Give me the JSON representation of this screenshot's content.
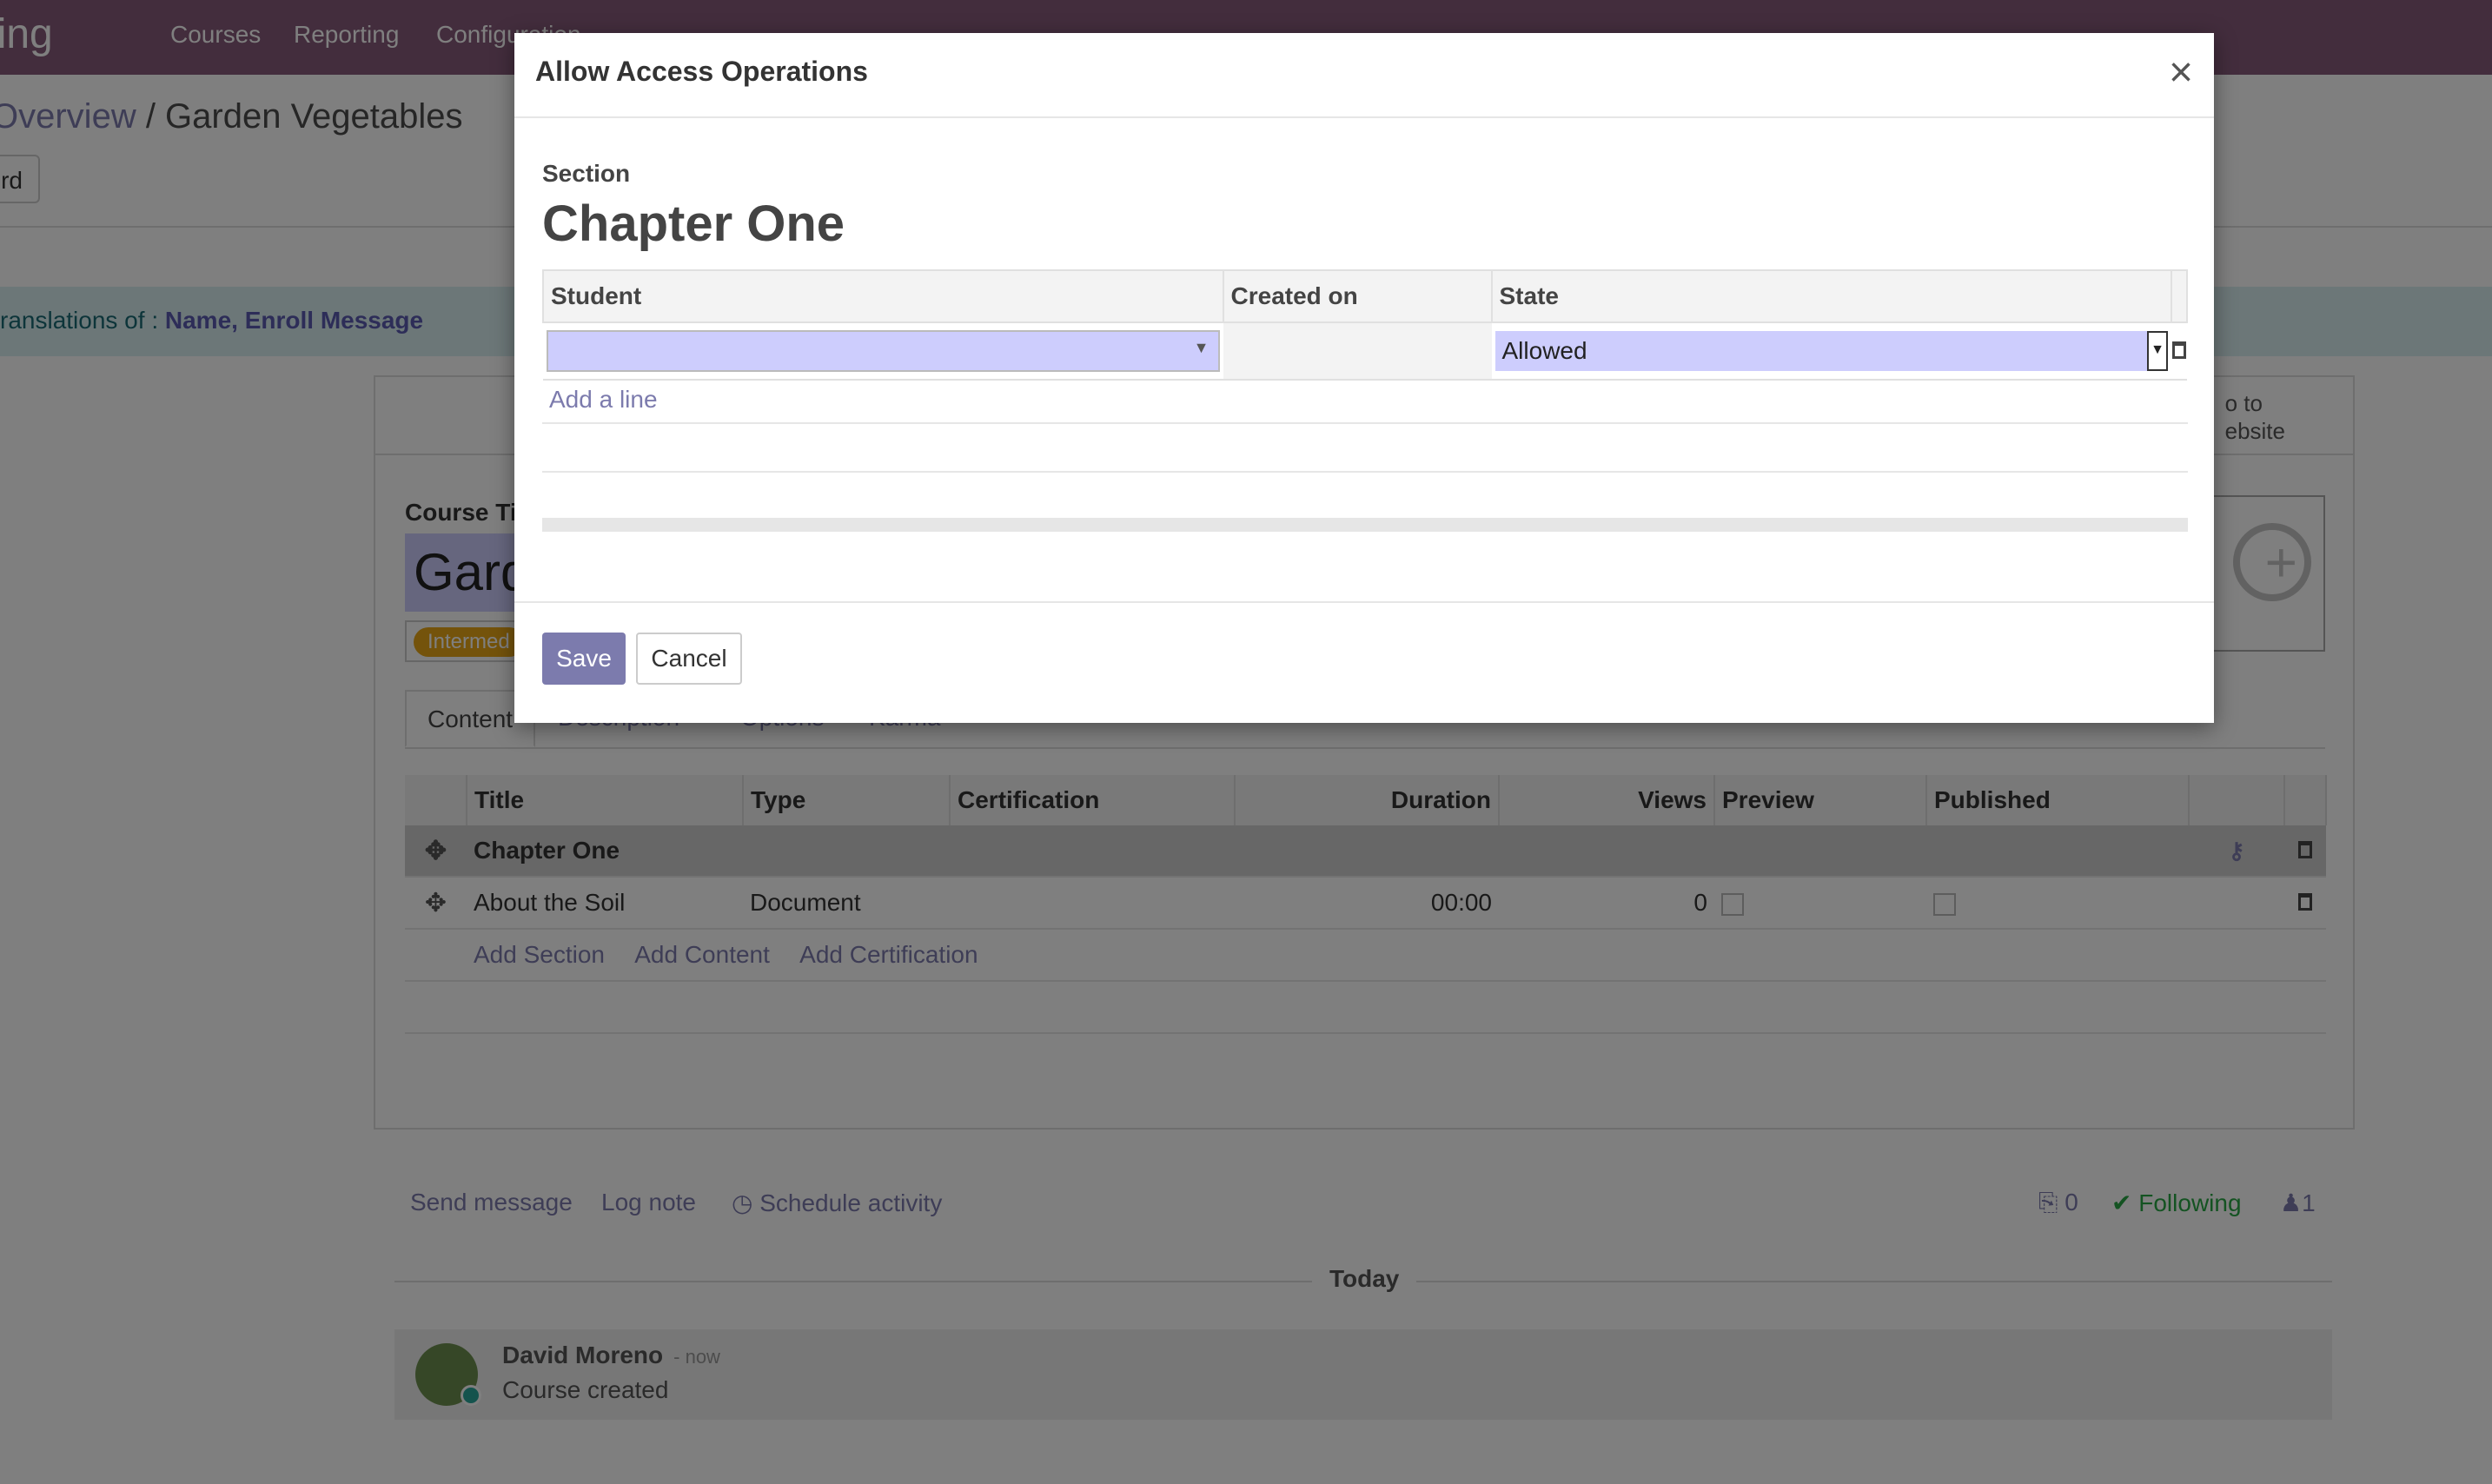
{
  "app": {
    "brand": "ning",
    "menu": [
      "Courses",
      "Reporting",
      "Configuration"
    ]
  },
  "breadcrumb": {
    "parent": "Overview",
    "separator": " / ",
    "current": "Garden Vegetables"
  },
  "control_panel": {
    "board_button": "rd"
  },
  "translation_alert": {
    "text": "ranslations of : ",
    "fields": "Name, Enroll Message"
  },
  "form": {
    "goto_website": "o to\nebsite",
    "course_title_label": "Course Ti",
    "course_title_value": "Gard",
    "tag": "Intermed",
    "tabs": [
      "Content",
      "Description",
      "Options",
      "Karma"
    ],
    "content_table": {
      "headers": [
        "",
        "Title",
        "Type",
        "Certification",
        "Duration",
        "Views",
        "Preview",
        "Published",
        "",
        ""
      ],
      "rows": [
        {
          "kind": "section",
          "title": "Chapter One"
        },
        {
          "kind": "line",
          "title": "About the Soil",
          "type": "Document",
          "certification": "",
          "duration": "00:00",
          "views": "0"
        }
      ],
      "add_links": [
        "Add Section",
        "Add Content",
        "Add Certification"
      ]
    }
  },
  "chatter": {
    "send_message": "Send message",
    "log_note": "Log note",
    "schedule_activity": "Schedule activity",
    "attachments_count": "0",
    "following": "Following",
    "followers_count": "1",
    "separator_label": "Today",
    "messages": [
      {
        "author": "David Moreno",
        "when": "- now",
        "body": "Course created"
      }
    ]
  },
  "dialog": {
    "title": "Allow Access Operations",
    "close_glyph": "×",
    "section_label": "Section",
    "section_name": "Chapter One",
    "table": {
      "headers": [
        "Student",
        "Created on",
        "State"
      ],
      "rows": [
        {
          "student": "",
          "created_on": "",
          "state": "Allowed"
        }
      ],
      "add_line": "Add a line"
    },
    "save_label": "Save",
    "cancel_label": "Cancel"
  },
  "colors": {
    "brand": "#875a7b",
    "primary": "#7c7bad",
    "required_field": "#cdcdfd",
    "tag": "#e8a617",
    "following": "#28a745"
  }
}
